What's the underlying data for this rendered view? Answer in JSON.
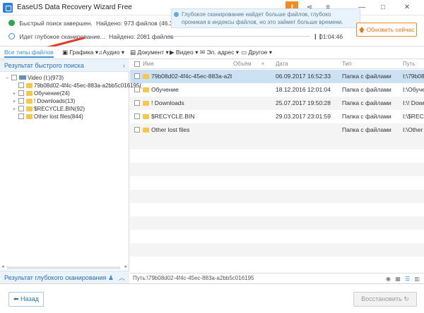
{
  "window": {
    "title": "EaseUS Data Recovery Wizard Free",
    "controls": [
      "—",
      "□",
      "✕"
    ]
  },
  "scan": {
    "quick_status": "Быстрый поиск завершен.",
    "quick_found": "Найдено: 973 файлов (46.34 GB)",
    "deep_status": "Идет глубокое сканирование...",
    "deep_found": "Найдено: 2081 файлов",
    "tooltip": "Глубокое сканирование найдет больше файлов, глубоко проникая в индексы файлов, но это займет больше времени.",
    "elapsed": "01:04:46",
    "update_button": "Обновить сейчас",
    "progress": 0.02
  },
  "filters": [
    {
      "label": "Все типы файлов",
      "icon": "",
      "active": true
    },
    {
      "label": "Графика",
      "icon": "image-icon"
    },
    {
      "label": "Аудио",
      "icon": "music-icon"
    },
    {
      "label": "Документ",
      "icon": "document-icon"
    },
    {
      "label": "Видео",
      "icon": "video-icon"
    },
    {
      "label": "Эл. адрес",
      "icon": "mail-icon"
    },
    {
      "label": "Другое",
      "icon": "other-icon"
    }
  ],
  "left_panel": {
    "header": "Результат быстрого поиска",
    "footer": "Результат глубокого сканирования",
    "tree": [
      {
        "label": "Video (I:)(973)",
        "icon": "drive-icon",
        "level": 0,
        "expander": "−"
      },
      {
        "label": "79b08d02-4f4c-45ec-883a-a2bb5c016195(",
        "icon": "folder-icon",
        "level": 1,
        "expander": ""
      },
      {
        "label": "Обучение(24)",
        "icon": "folder-icon",
        "level": 1,
        "expander": "+"
      },
      {
        "label": "! Downloads(13)",
        "icon": "folder-icon",
        "level": 1,
        "expander": "+"
      },
      {
        "label": "$RECYCLE.BIN(92)",
        "icon": "folder-icon",
        "level": 1,
        "expander": "+"
      },
      {
        "label": "Other lost files(844)",
        "icon": "folder-icon",
        "level": 1,
        "expander": ""
      }
    ]
  },
  "table": {
    "columns": [
      "Имя",
      "Объём",
      "Дата",
      "Тип",
      "Путь"
    ],
    "rows": [
      {
        "name": "79b08d02-4f4c-45ec-883a-a2bb...",
        "size": "",
        "date": "06.09.2017 16:52:33",
        "type": "Папка с файлами",
        "path": "I:\\79b08d0",
        "selected": true
      },
      {
        "name": "Обучение",
        "size": "",
        "date": "18.12.2016 12:01:04",
        "type": "Папка с файлами",
        "path": "I:\\Обучен"
      },
      {
        "name": "! Downloads",
        "size": "",
        "date": "25.07.2017 19:50:28",
        "type": "Папка с файлами",
        "path": "I:\\! Downl"
      },
      {
        "name": "$RECYCLE.BIN",
        "size": "",
        "date": "29.03.2017 23:01:59",
        "type": "Папка с файлами",
        "path": "I:\\$RECY"
      },
      {
        "name": "Other lost files",
        "size": "",
        "date": "",
        "type": "Папка с файлами",
        "path": "I:\\Other l"
      }
    ],
    "path_label": "Путь:\\79b08d02-4f4c-45ec-883a-a2bb5c016195"
  },
  "footer": {
    "back_button": "Назад",
    "restore_button": "Восстановить"
  },
  "colors": {
    "accent": "#3b8fd9",
    "update": "#f08a24",
    "selection": "#cde1f5",
    "ok": "#2ca84a",
    "arrow": "#e03b2e"
  }
}
